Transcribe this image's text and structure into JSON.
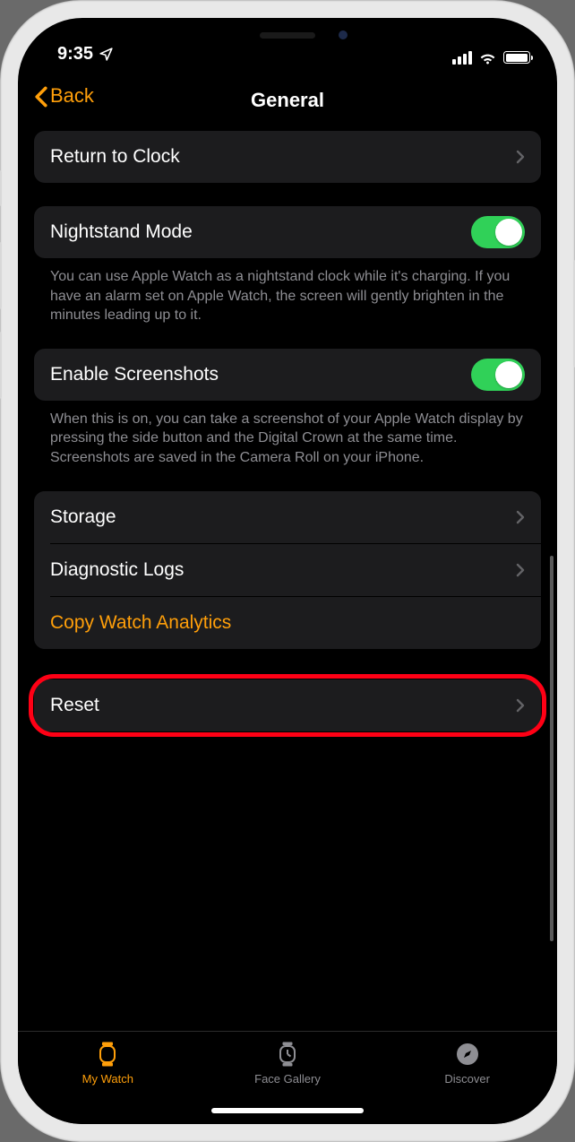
{
  "statusbar": {
    "time": "9:35"
  },
  "nav": {
    "back": "Back",
    "title": "General"
  },
  "rows": {
    "return_clock": "Return to Clock",
    "nightstand": "Nightstand Mode",
    "nightstand_desc": "You can use Apple Watch as a nightstand clock while it's charging. If you have an alarm set on Apple Watch, the screen will gently brighten in the minutes leading up to it.",
    "screenshots": "Enable Screenshots",
    "screenshots_desc": "When this is on, you can take a screenshot of your Apple Watch display by pressing the side button and the Digital Crown at the same time. Screenshots are saved in the Camera Roll on your iPhone.",
    "storage": "Storage",
    "diag": "Diagnostic Logs",
    "analytics": "Copy Watch Analytics",
    "reset": "Reset"
  },
  "toggles": {
    "nightstand": true,
    "screenshots": true
  },
  "tabs": {
    "mywatch": "My Watch",
    "facegallery": "Face Gallery",
    "discover": "Discover"
  }
}
